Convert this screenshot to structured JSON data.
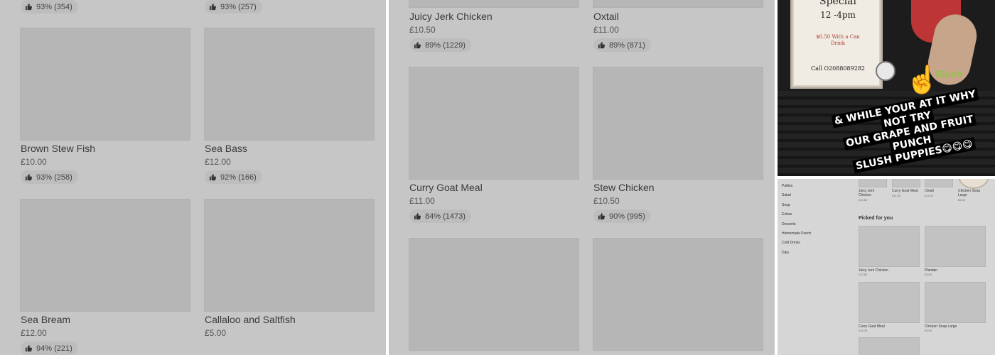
{
  "panel1": {
    "items": [
      {
        "name": "",
        "price": "",
        "rating": "93% (354)"
      },
      {
        "name": "",
        "price": "",
        "rating": "93% (257)"
      },
      {
        "name": "Brown Stew Fish",
        "price": "£10.00",
        "rating": "93% (258)"
      },
      {
        "name": "Sea Bass",
        "price": "£12.00",
        "rating": "92% (166)"
      },
      {
        "name": "Sea Bream",
        "price": "£12.00",
        "rating": "94% (221)"
      },
      {
        "name": "Callaloo and Saltfish",
        "price": "£5.00",
        "rating": ""
      }
    ]
  },
  "panel2": {
    "items": [
      {
        "name": "Juicy Jerk Chicken",
        "price": "£10.50",
        "rating": "89% (1229)"
      },
      {
        "name": "Oxtail",
        "price": "£11.00",
        "rating": "89% (871)"
      },
      {
        "name": "Curry Goat Meal",
        "price": "£11.00",
        "rating": "84% (1473)"
      },
      {
        "name": "Stew Chicken",
        "price": "£10.50",
        "rating": "90% (995)"
      }
    ]
  },
  "photo": {
    "sign_title": "Special",
    "sign_time": "12 -4pm",
    "sign_offer_line1": "$6.50 With a Can",
    "sign_offer_line2": "Drink",
    "sign_phone": "Call O2088089282",
    "slush_word": "Slush",
    "promo_line1": "& WHILE YOUR AT IT WHY NOT TRY",
    "promo_line2": "OUR GRAPE AND FRUIT PUNCH",
    "promo_line3": "SLUSH PUPPIES😋😋😋"
  },
  "mini_menu": {
    "categories": [
      "Patties",
      "Salad",
      "Soup",
      "Extras",
      "Desserts",
      "Homemade Punch",
      "Cold Drinks",
      "Dips"
    ],
    "top_items": [
      {
        "name": "Juicy Jerk Chicken",
        "price": "£10.50"
      },
      {
        "name": "Curry Goat Meal",
        "price": "£11.00"
      },
      {
        "name": "Oxtail",
        "price": "£11.00"
      },
      {
        "name": "Chicken Soup Large",
        "price": "£5.00"
      }
    ],
    "heading": "Picked for you",
    "picked": [
      {
        "name": "Juicy Jerk Chicken",
        "price": "£10.50"
      },
      {
        "name": "Plantain",
        "price": "£3.00"
      },
      {
        "name": "Curry Goat Meal",
        "price": "£11.00"
      },
      {
        "name": "Chicken Soup Large",
        "price": "£5.00"
      }
    ]
  }
}
